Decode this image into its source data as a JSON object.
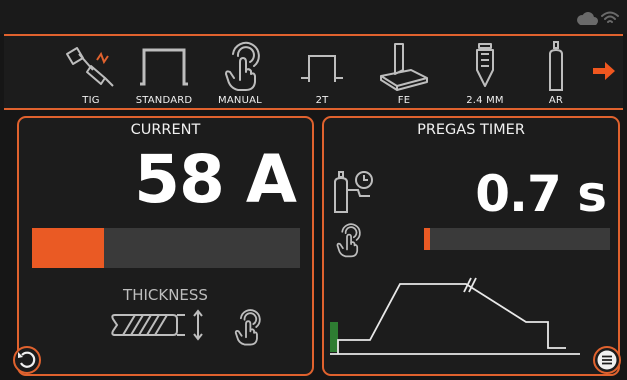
{
  "status": {
    "icons": [
      "cloud-icon",
      "wifi-icon"
    ]
  },
  "modes": [
    {
      "id": "process",
      "label": "TIG",
      "icon": "tig-torch-icon"
    },
    {
      "id": "arc",
      "label": "STANDARD",
      "icon": "standard-wave-icon"
    },
    {
      "id": "control",
      "label": "MANUAL",
      "icon": "manual-hand-icon"
    },
    {
      "id": "trigger",
      "label": "2T",
      "icon": "2t-trigger-icon"
    },
    {
      "id": "material",
      "label": "FE",
      "icon": "fe-material-icon"
    },
    {
      "id": "electrode",
      "label": "2.4 MM",
      "icon": "electrode-icon"
    },
    {
      "id": "gas",
      "label": "AR",
      "icon": "gas-cylinder-icon"
    }
  ],
  "current": {
    "title": "CURRENT",
    "value": "58 A",
    "level": 0.27,
    "thickness_label": "THICKNESS"
  },
  "pregas": {
    "title": "PREGAS TIMER",
    "value": "0.7 s",
    "level": 0.03
  },
  "colors": {
    "accent": "#e0622e",
    "bar_fill": "#ea5a24",
    "track": "#3a3a3a",
    "curve": "#e8e8e8",
    "gas": "#2e7d32"
  }
}
